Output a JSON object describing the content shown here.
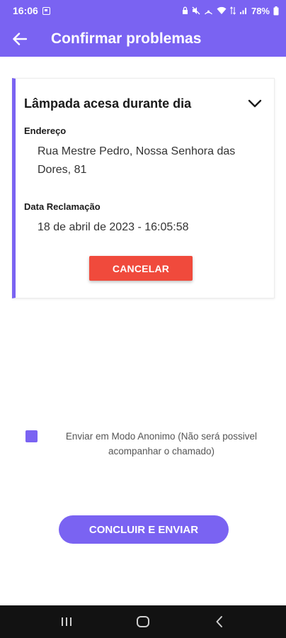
{
  "status_bar": {
    "time": "16:06",
    "battery": "78%"
  },
  "app_bar": {
    "title": "Confirmar problemas"
  },
  "complaint": {
    "title": "Lâmpada acesa durante dia",
    "address_label": "Endereço",
    "address_value": "Rua Mestre Pedro, Nossa Senhora das Dores, 81",
    "date_label": "Data Reclamação",
    "date_value": "18 de abril de 2023 - 16:05:58",
    "cancel_label": "CANCELAR"
  },
  "anonymous": {
    "label": "Enviar em Modo Anonimo (Não será possivel acompanhar o chamado)",
    "checked": true
  },
  "submit": {
    "label": "CONCLUIR E ENVIAR"
  },
  "colors": {
    "primary": "#7a63f2",
    "danger": "#f04a3c",
    "nav_bar": "#121212"
  },
  "icons": {
    "back": "arrow-left-icon",
    "expand": "chevron-down-icon",
    "nav_recents": "recents-icon",
    "nav_home": "home-icon",
    "nav_back": "nav-back-icon"
  }
}
